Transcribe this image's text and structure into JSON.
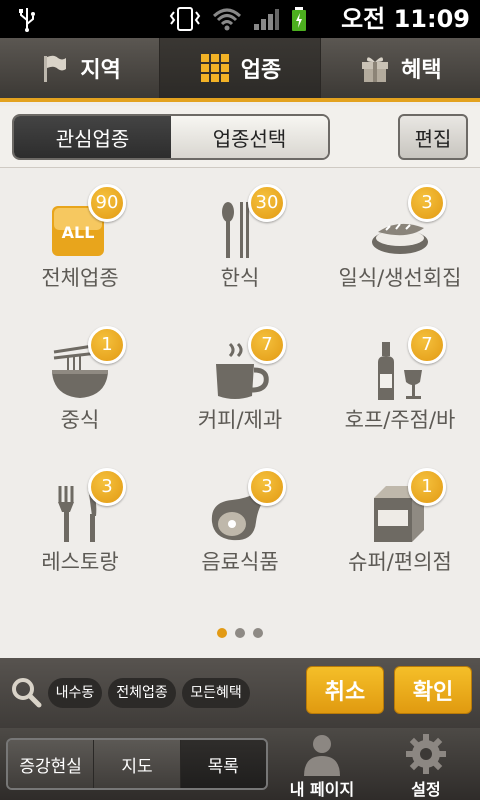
{
  "status_bar": {
    "time": "오전 11:09"
  },
  "top_tabs": [
    {
      "label": "지역",
      "icon": "flag-icon"
    },
    {
      "label": "업종",
      "icon": "grid-icon",
      "active": true
    },
    {
      "label": "혜택",
      "icon": "gift-icon"
    }
  ],
  "segmented": {
    "interest": "관심업종",
    "select": "업종선택",
    "edit": "편집"
  },
  "categories": [
    {
      "label": "전체업종",
      "count": "90",
      "icon": "all-icon"
    },
    {
      "label": "한식",
      "count": "30",
      "icon": "spoon-chopsticks-icon"
    },
    {
      "label": "일식/생선회집",
      "count": "3",
      "icon": "sushi-icon"
    },
    {
      "label": "중식",
      "count": "1",
      "icon": "noodle-bowl-icon"
    },
    {
      "label": "커피/제과",
      "count": "7",
      "icon": "coffee-cup-icon"
    },
    {
      "label": "호프/주점/바",
      "count": "7",
      "icon": "bottle-glass-icon"
    },
    {
      "label": "레스토랑",
      "count": "3",
      "icon": "fork-knife-icon"
    },
    {
      "label": "음료식품",
      "count": "3",
      "icon": "ham-icon"
    },
    {
      "label": "슈퍼/편의점",
      "count": "1",
      "icon": "milk-carton-icon"
    }
  ],
  "filter": {
    "chips": [
      "내수동",
      "전체업종",
      "모든혜택"
    ],
    "cancel": "취소",
    "confirm": "확인"
  },
  "bottom": {
    "views": [
      "증강현실",
      "지도",
      "목록"
    ],
    "mypage": "내 페이지",
    "settings": "설정"
  },
  "colors": {
    "accent": "#e29a14"
  }
}
